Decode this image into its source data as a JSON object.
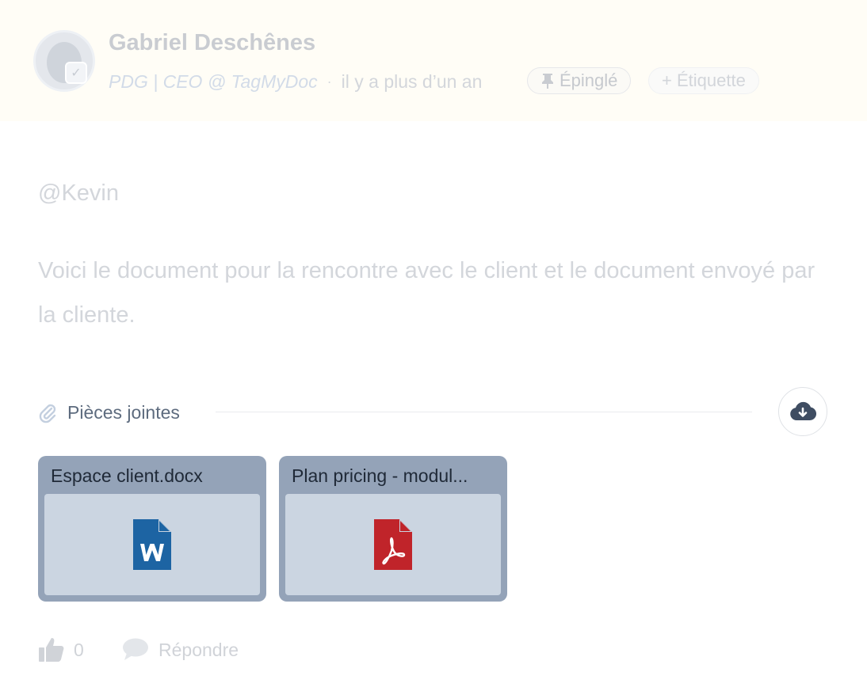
{
  "post": {
    "author": "Gabriel Deschênes",
    "role": "PDG | CEO @ TagMyDoc",
    "separator": "·",
    "time": "il y a plus d’un an",
    "pinned_label": "Épinglé",
    "tag_label": "+ Étiquette",
    "mention": "@Kevin",
    "message": "Voici le document pour la rencontre avec le client et le document envoyé par la cliente."
  },
  "attachments": {
    "title": "Pièces jointes",
    "files": [
      {
        "name": "Espace client.docx",
        "type": "word-document-icon"
      },
      {
        "name": "Plan pricing - modul...",
        "type": "pdf-document-icon"
      }
    ]
  },
  "actions": {
    "like_count": "0",
    "reply_label": "Répondre"
  },
  "colors": {
    "header_bg": "#fffdf6",
    "card_bg": "#94a3b8",
    "preview_bg": "#cbd5e1",
    "word_blue": "#1d64a3",
    "pdf_red": "#c0242a"
  }
}
